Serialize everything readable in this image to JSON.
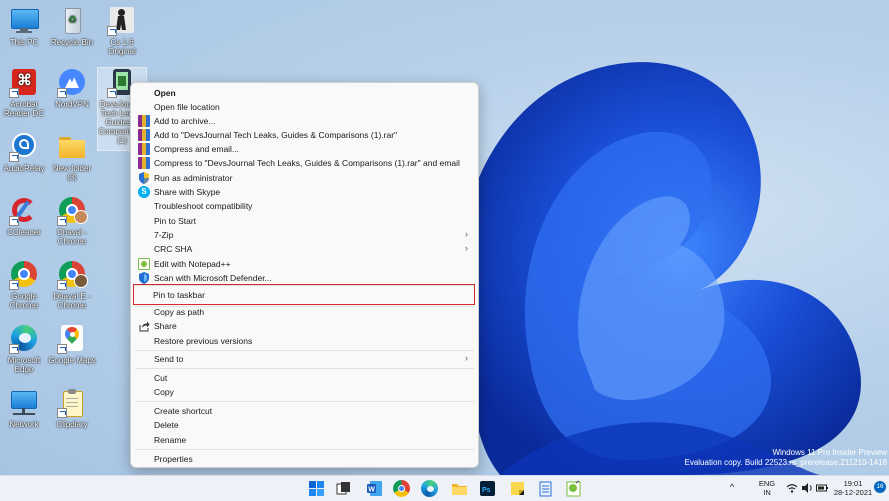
{
  "desktop": {
    "icons": [
      {
        "label": "This PC",
        "icon": "this-pc-icon"
      },
      {
        "label": "Recycle Bin",
        "icon": "recycle-bin-icon"
      },
      {
        "label": "Cs 1.6 Original",
        "icon": "counter-strike-icon"
      },
      {
        "label": "Acrobat Reader DC",
        "icon": "acrobat-reader-icon"
      },
      {
        "label": "NordVPN",
        "icon": "nordvpn-icon"
      },
      {
        "label": "DevsJournal Tech Leaks, Guides & Comparisons (1)",
        "icon": "winrar-archive-icon"
      },
      {
        "label": "AudioRelay",
        "icon": "audiorelay-icon"
      },
      {
        "label": "New folder (3)",
        "icon": "folder-icon"
      },
      {
        "label": "CCleaner",
        "icon": "ccleaner-icon"
      },
      {
        "label": "Dhaval - Chrome",
        "icon": "chrome-profile-icon"
      },
      {
        "label": "Google Chrome",
        "icon": "chrome-icon"
      },
      {
        "label": "Dhaval E - Chrome",
        "icon": "chrome-profile-icon"
      },
      {
        "label": "Microsoft Edge",
        "icon": "edge-icon"
      },
      {
        "label": "Google Maps",
        "icon": "google-maps-icon"
      },
      {
        "label": "Network",
        "icon": "network-icon"
      },
      {
        "label": "Clipdiary",
        "icon": "clipdiary-icon"
      }
    ]
  },
  "context_menu": {
    "items": [
      {
        "label": "Open",
        "icon": "",
        "bold": true
      },
      {
        "label": "Open file location",
        "icon": ""
      },
      {
        "label": "Add to archive...",
        "icon": "winrar-icon"
      },
      {
        "label": "Add to \"DevsJournal   Tech Leaks, Guides & Comparisons (1).rar\"",
        "icon": "winrar-icon"
      },
      {
        "label": "Compress and email...",
        "icon": "winrar-icon"
      },
      {
        "label": "Compress to \"DevsJournal   Tech Leaks, Guides & Comparisons (1).rar\" and email",
        "icon": "winrar-icon"
      },
      {
        "label": "Run as administrator",
        "icon": "uac-shield-icon"
      },
      {
        "label": "Share with Skype",
        "icon": "skype-icon"
      },
      {
        "label": "Troubleshoot compatibility",
        "icon": ""
      },
      {
        "label": "Pin to Start",
        "icon": ""
      },
      {
        "label": "7-Zip",
        "icon": "",
        "submenu": true
      },
      {
        "label": "CRC SHA",
        "icon": "",
        "submenu": true
      },
      {
        "label": "Edit with Notepad++",
        "icon": "notepad-plus-plus-icon"
      },
      {
        "label": "Scan with Microsoft Defender...",
        "icon": "defender-icon"
      },
      {
        "label": "Pin to taskbar",
        "icon": "",
        "highlighted": true
      },
      {
        "label": "Copy as path",
        "icon": ""
      },
      {
        "label": "Share",
        "icon": "share-icon"
      },
      {
        "label": "Restore previous versions",
        "icon": ""
      },
      {
        "label": "Send to",
        "icon": "",
        "submenu": true
      },
      {
        "label": "Cut",
        "icon": ""
      },
      {
        "label": "Copy",
        "icon": ""
      },
      {
        "label": "Create shortcut",
        "icon": ""
      },
      {
        "label": "Delete",
        "icon": ""
      },
      {
        "label": "Rename",
        "icon": ""
      },
      {
        "label": "Properties",
        "icon": ""
      }
    ]
  },
  "watermark": {
    "line1": "Windows 11 Pro Insider Preview",
    "line2": "Evaluation copy. Build 22523.rs_prerelease.211210-1418"
  },
  "taskbar": {
    "apps": [
      "start-icon",
      "task-view-icon",
      "word-icon",
      "chrome-icon",
      "edge-icon",
      "file-explorer-icon",
      "photoshop-icon",
      "sticky-notes-icon",
      "notepad-icon",
      "notepad-plus-plus-icon"
    ],
    "tray": {
      "chevron": "^",
      "lang_top": "ENG",
      "lang_bottom": "IN",
      "time": "19:01",
      "date": "28-12-2021",
      "badge": "16"
    }
  },
  "colors": {
    "accent": "#0067c0",
    "highlight_box": "#d4272b",
    "wallpaper_bloom": "#1a4fd8"
  }
}
